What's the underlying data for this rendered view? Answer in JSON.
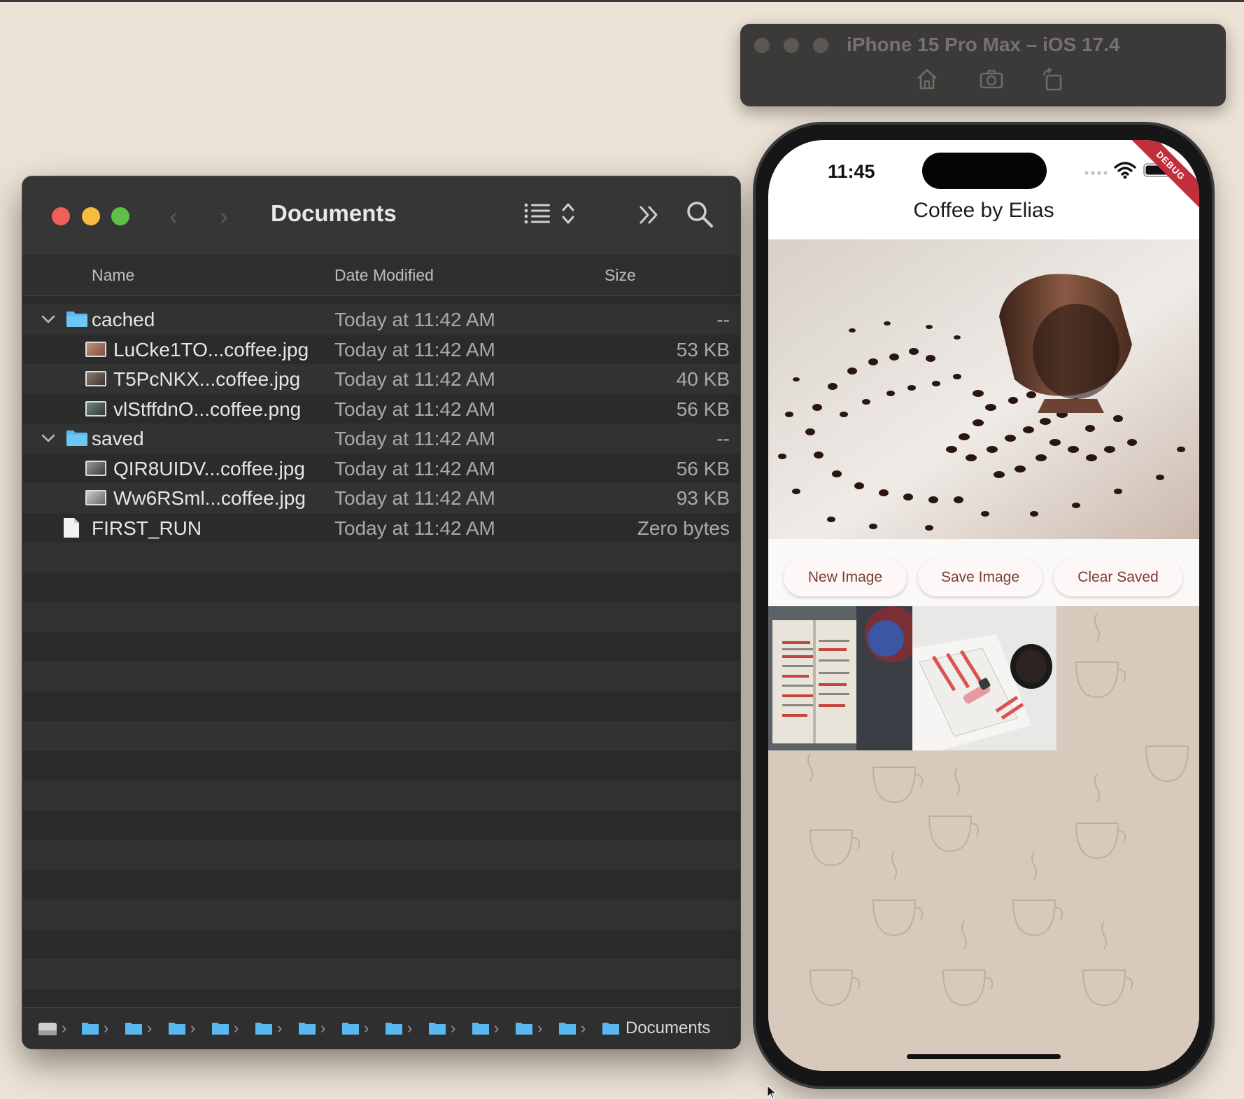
{
  "finder": {
    "title": "Documents",
    "columns": {
      "name": "Name",
      "date": "Date Modified",
      "size": "Size"
    },
    "rows": [
      {
        "name": "cached",
        "date": "Today at 11:42 AM",
        "size": "--"
      },
      {
        "name": "LuCke1TO...coffee.jpg",
        "date": "Today at 11:42 AM",
        "size": "53 KB"
      },
      {
        "name": "T5PcNKX...coffee.jpg",
        "date": "Today at 11:42 AM",
        "size": "40 KB"
      },
      {
        "name": "vlStffdnO...coffee.png",
        "date": "Today at 11:42 AM",
        "size": "56 KB"
      },
      {
        "name": "saved",
        "date": "Today at 11:42 AM",
        "size": "--"
      },
      {
        "name": "QIR8UIDV...coffee.jpg",
        "date": "Today at 11:42 AM",
        "size": "56 KB"
      },
      {
        "name": "Ww6RSml...coffee.jpg",
        "date": "Today at 11:42 AM",
        "size": "93 KB"
      },
      {
        "name": "FIRST_RUN",
        "date": "Today at 11:42 AM",
        "size": "Zero bytes"
      }
    ],
    "path": {
      "current": "Documents"
    }
  },
  "simulator": {
    "title": "iPhone 15 Pro Max – iOS 17.4",
    "icons": [
      "home-icon",
      "screenshot-icon",
      "rotate-icon"
    ]
  },
  "phone": {
    "time": "11:45",
    "debug": "DEBUG",
    "app_title": "Coffee by Elias",
    "buttons": {
      "new": "New Image",
      "save": "Save Image",
      "clear": "Clear Saved"
    }
  },
  "colors": {
    "accent_button_text": "#7a3d2d",
    "folder_blue": "#5ab8f0",
    "close": "#ed5f57",
    "minimize": "#f5bd3d",
    "zoom": "#5dc145"
  }
}
